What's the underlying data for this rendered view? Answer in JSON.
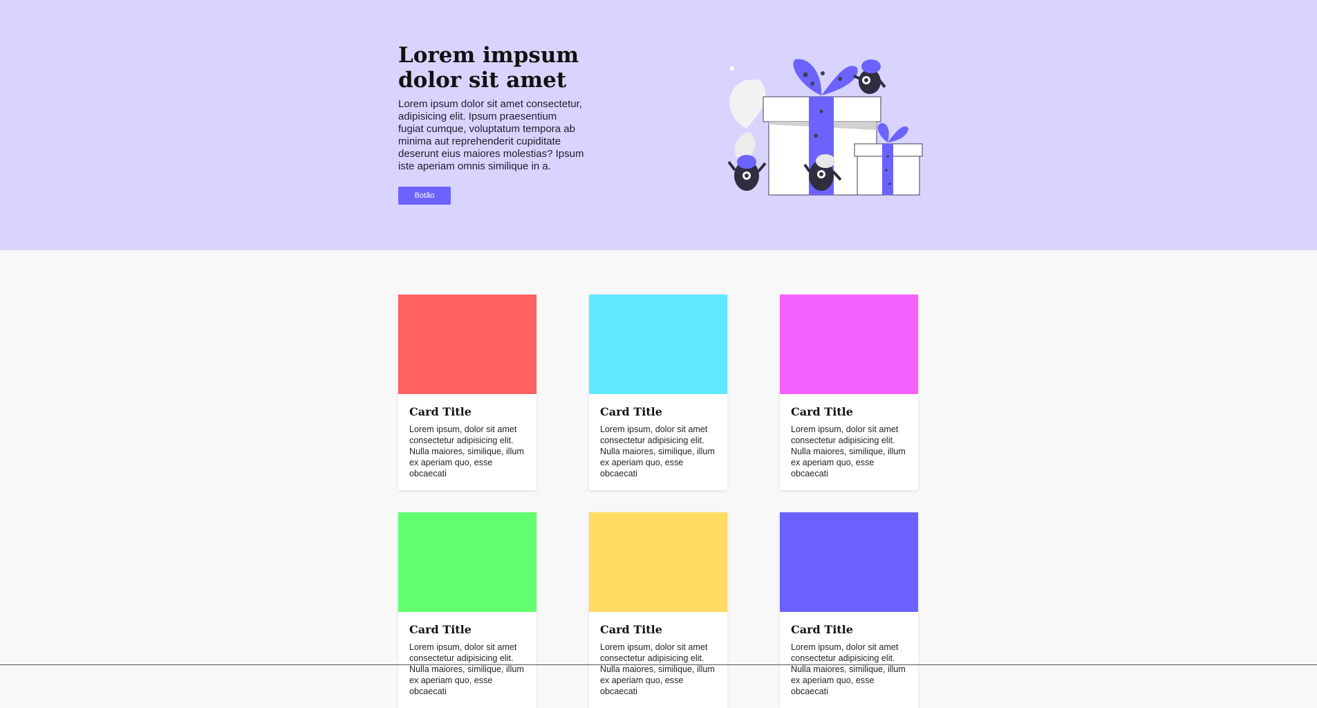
{
  "hero": {
    "title": "Lorem impsum dolor sit amet",
    "description": "Lorem ipsum dolor sit amet consectetur, adipisicing elit. Ipsum praesentium fugiat cumque, voluptatum tempora ab minima aut reprehenderit cupiditate deserunt eius maiores molestias? Ipsum iste aperiam omnis similique in a.",
    "button_label": "Botão",
    "accent_color": "#6c63ff",
    "background_color": "#d8d4ff"
  },
  "cards": [
    {
      "title": "Card Title",
      "text": "Lorem ipsum, dolor sit amet consectetur adipisicing elit. Nulla maiores, similique, illum ex aperiam quo, esse obcaecati",
      "color": "#ff6161"
    },
    {
      "title": "Card Title",
      "text": "Lorem ipsum, dolor sit amet consectetur adipisicing elit. Nulla maiores, similique, illum ex aperiam quo, esse obcaecati",
      "color": "#61e8ff"
    },
    {
      "title": "Card Title",
      "text": "Lorem ipsum, dolor sit amet consectetur adipisicing elit. Nulla maiores, similique, illum ex aperiam quo, esse obcaecati",
      "color": "#f561ff"
    },
    {
      "title": "Card Title",
      "text": "Lorem ipsum, dolor sit amet consectetur adipisicing elit. Nulla maiores, similique, illum ex aperiam quo, esse obcaecati",
      "color": "#61ff6f"
    },
    {
      "title": "Card Title",
      "text": "Lorem ipsum, dolor sit amet consectetur adipisicing elit. Nulla maiores, similique, illum ex aperiam quo, esse obcaecati",
      "color": "#ffdb61"
    },
    {
      "title": "Card Title",
      "text": "Lorem ipsum, dolor sit amet consectetur adipisicing elit. Nulla maiores, similique, illum ex aperiam quo, esse obcaecati",
      "color": "#6b61ff"
    }
  ],
  "illustration": {
    "icon": "gift-boxes-monsters-illustration"
  }
}
